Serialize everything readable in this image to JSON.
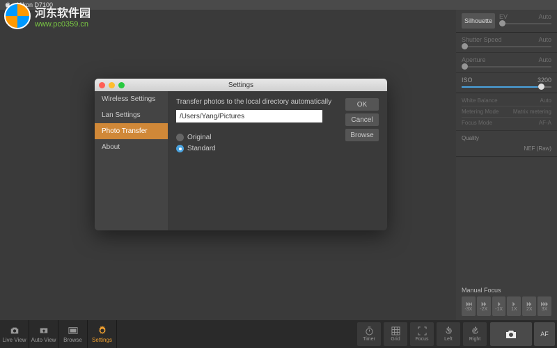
{
  "menubar": {
    "app": "Nikon D7100"
  },
  "watermark": {
    "cn": "河东软件园",
    "url": "www.pc0359.cn"
  },
  "right": {
    "silhouette": "Silhouette",
    "ev": {
      "label": "EV",
      "value": "Auto"
    },
    "shutter": {
      "label": "Shutter Speed",
      "value": "Auto"
    },
    "aperture": {
      "label": "Aperture",
      "value": "Auto"
    },
    "iso": {
      "label": "ISO",
      "value": "3200"
    },
    "wb": {
      "label": "White Balance",
      "value": "Auto"
    },
    "metering": {
      "label": "Metering Mode",
      "value": "Matrix metering"
    },
    "focus": {
      "label": "Focus Mode",
      "value": "AF-A"
    },
    "quality": {
      "label": "Quality",
      "value": "NEF (Raw)"
    },
    "mf": {
      "label": "Manual Focus",
      "btns": [
        "-3X",
        "-2X",
        "-1X",
        "1X",
        "2X",
        "3X"
      ]
    }
  },
  "bottom": {
    "live": "Live View",
    "auto": "Auto View",
    "browse": "Browse",
    "settings": "Settings",
    "timer": "Timer",
    "grid": "Grid",
    "focus": "Focus",
    "left": "Left",
    "right": "Right",
    "af": "AF"
  },
  "dialog": {
    "title": "Settings",
    "side": [
      "Wireless Settings",
      "Lan Settings",
      "Photo Transfer",
      "About"
    ],
    "heading": "Transfer photos to the local directory automatically",
    "path": "/Users/Yang/Pictures",
    "ok": "OK",
    "cancel": "Cancel",
    "browse": "Browse",
    "opt1": "Original",
    "opt2": "Standard"
  }
}
